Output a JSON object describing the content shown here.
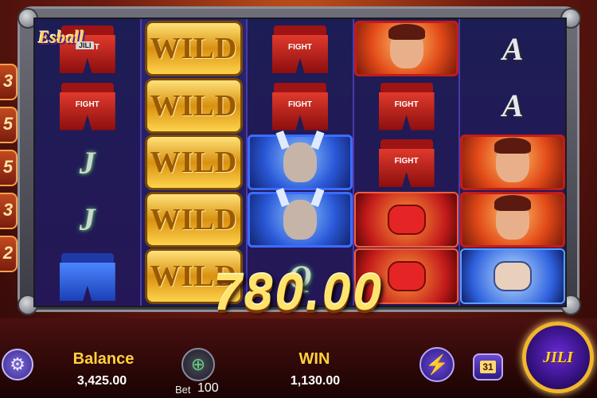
{
  "logo": {
    "text": "Esball",
    "sub": "JILI"
  },
  "reels": [
    [
      {
        "kind": "shorts",
        "label": "FIGHT"
      },
      {
        "kind": "shorts",
        "label": "FIGHT"
      },
      {
        "kind": "letter",
        "text": "J"
      },
      {
        "kind": "letter",
        "text": "J"
      },
      {
        "kind": "shorts-blue",
        "label": ""
      }
    ],
    [
      {
        "kind": "wild",
        "text": "WILD"
      },
      {
        "kind": "wild",
        "text": "WILD"
      },
      {
        "kind": "wild",
        "text": "WILD"
      },
      {
        "kind": "wild",
        "text": "WILD"
      },
      {
        "kind": "wild",
        "text": "WILD"
      }
    ],
    [
      {
        "kind": "shorts",
        "label": "FIGHT"
      },
      {
        "kind": "shorts",
        "label": "FIGHT"
      },
      {
        "kind": "fighter-blue"
      },
      {
        "kind": "fighter-blue"
      },
      {
        "kind": "letter",
        "text": "Q"
      }
    ],
    [
      {
        "kind": "fighter-red"
      },
      {
        "kind": "shorts",
        "label": "FIGHT"
      },
      {
        "kind": "shorts",
        "label": "FIGHT"
      },
      {
        "kind": "glove-red"
      },
      {
        "kind": "glove-red"
      }
    ],
    [
      {
        "kind": "letter",
        "text": "A"
      },
      {
        "kind": "letter",
        "text": "A"
      },
      {
        "kind": "fighter-red"
      },
      {
        "kind": "fighter-red"
      },
      {
        "kind": "glove-blue"
      }
    ]
  ],
  "win_amount": "780.00",
  "balance": {
    "label": "Balance",
    "value": "3,425.00"
  },
  "bet": {
    "label": "Bet",
    "value": "100"
  },
  "win": {
    "label": "WIN",
    "value": "1,130.00"
  },
  "auto_spin": {
    "count": "31"
  },
  "spin_button": {
    "text": "JILI"
  },
  "side_tabs": [
    "3",
    "5",
    "5",
    "3",
    "2"
  ],
  "colors": {
    "accent_gold": "#ffd23a",
    "frame": "#6e6f78",
    "reel_bg": "#1d1d55"
  }
}
